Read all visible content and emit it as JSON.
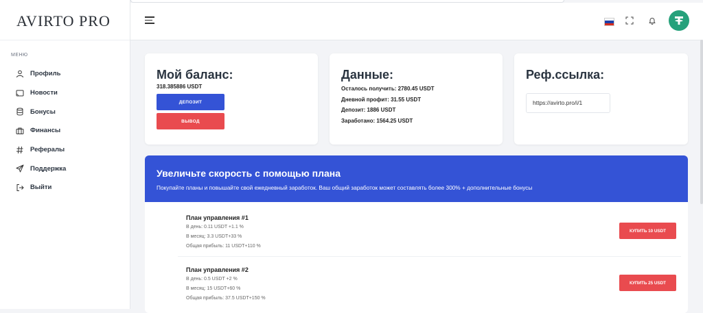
{
  "sidebar": {
    "logo": "AVIRTO PRO",
    "menu_title": "МЕНЮ",
    "items": [
      {
        "label": "Профиль",
        "icon": "user-icon"
      },
      {
        "label": "Новости",
        "icon": "cast-icon"
      },
      {
        "label": "Бонусы",
        "icon": "database-icon"
      },
      {
        "label": "Финансы",
        "icon": "briefcase-icon"
      },
      {
        "label": "Рефералы",
        "icon": "hash-icon"
      },
      {
        "label": "Поддержка",
        "icon": "send-icon"
      },
      {
        "label": "Выйти",
        "icon": "logout-icon"
      }
    ]
  },
  "header": {
    "icons": [
      "menu-icon",
      "flag-ru-icon",
      "fullscreen-icon",
      "bell-icon",
      "tether-avatar-icon"
    ]
  },
  "balance": {
    "title": "Мой баланс:",
    "amount": "318.385886 USDT",
    "deposit_label": "ДЕПОЗИТ",
    "withdraw_label": "ВЫВОД"
  },
  "data": {
    "title": "Данные:",
    "rows": [
      "Осталось получить: 2780.45 USDT",
      "Дневной профит: 31.55 USDT",
      "Депозит: 1886 USDT",
      "Заработано: 1564.25 USDT"
    ]
  },
  "ref": {
    "title": "Реф.ссылка:",
    "link": "https://avirto.pro/i/1"
  },
  "plans": {
    "title": "Увеличьте скорость с помощью плана",
    "subtitle": "Покупайте планы и повышайте свой ежедневный заработок. Ваш общий заработок может составлять более 300% + дополнительные бонусы",
    "items": [
      {
        "name": "План управления #1",
        "per_day": "В день: 0.11 USDT +1.1 %",
        "per_month": "В месяц: 3.3 USDT+33 %",
        "total": "Общая прибыль: 11 USDT+110 %",
        "buy_label": "КУПИТЬ 10 USDT"
      },
      {
        "name": "План управления #2",
        "per_day": "В день: 0.5 USDT +2 %",
        "per_month": "В месяц: 15 USDT+60 %",
        "total": "Общая прибыль: 37.5 USDT+150 %",
        "buy_label": "КУПИТЬ 25 USDT"
      }
    ]
  },
  "colors": {
    "primary": "#3453d6",
    "danger": "#e94b4f",
    "tether": "#26a17b"
  }
}
